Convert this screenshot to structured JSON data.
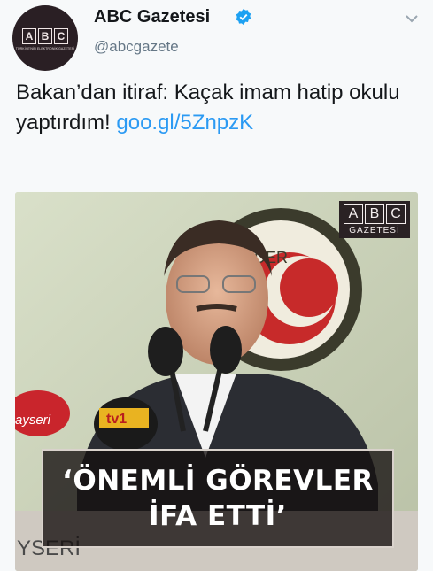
{
  "header": {
    "name": "ABC Gazetesi",
    "handle": "@abcgazete",
    "avatar_letters": [
      "A",
      "B",
      "C"
    ],
    "avatar_subtitle": "TÜRKİYE'NİN ELEKTRONİK GAZETESİ"
  },
  "tweet": {
    "text": "Bakan’dan itiraf: Kaçak imam hatip okulu yaptırdım! ",
    "link": "goo.gl/5ZnpzK"
  },
  "media": {
    "badge_letters": [
      "A",
      "B",
      "C"
    ],
    "badge_subtitle": "GAZETESİ",
    "banner_line1": "‘ÖNEMLİ GÖREVLER",
    "banner_line2": "İFA ETTİ’",
    "sign_text": "İMDER",
    "mic_brand": "tv1",
    "sign_left": "ayseri"
  },
  "colors": {
    "link": "#2b9af3",
    "verified": "#1da1f2"
  },
  "icons": {
    "verified": "verified-badge-icon",
    "menu": "chevron-down-icon"
  }
}
